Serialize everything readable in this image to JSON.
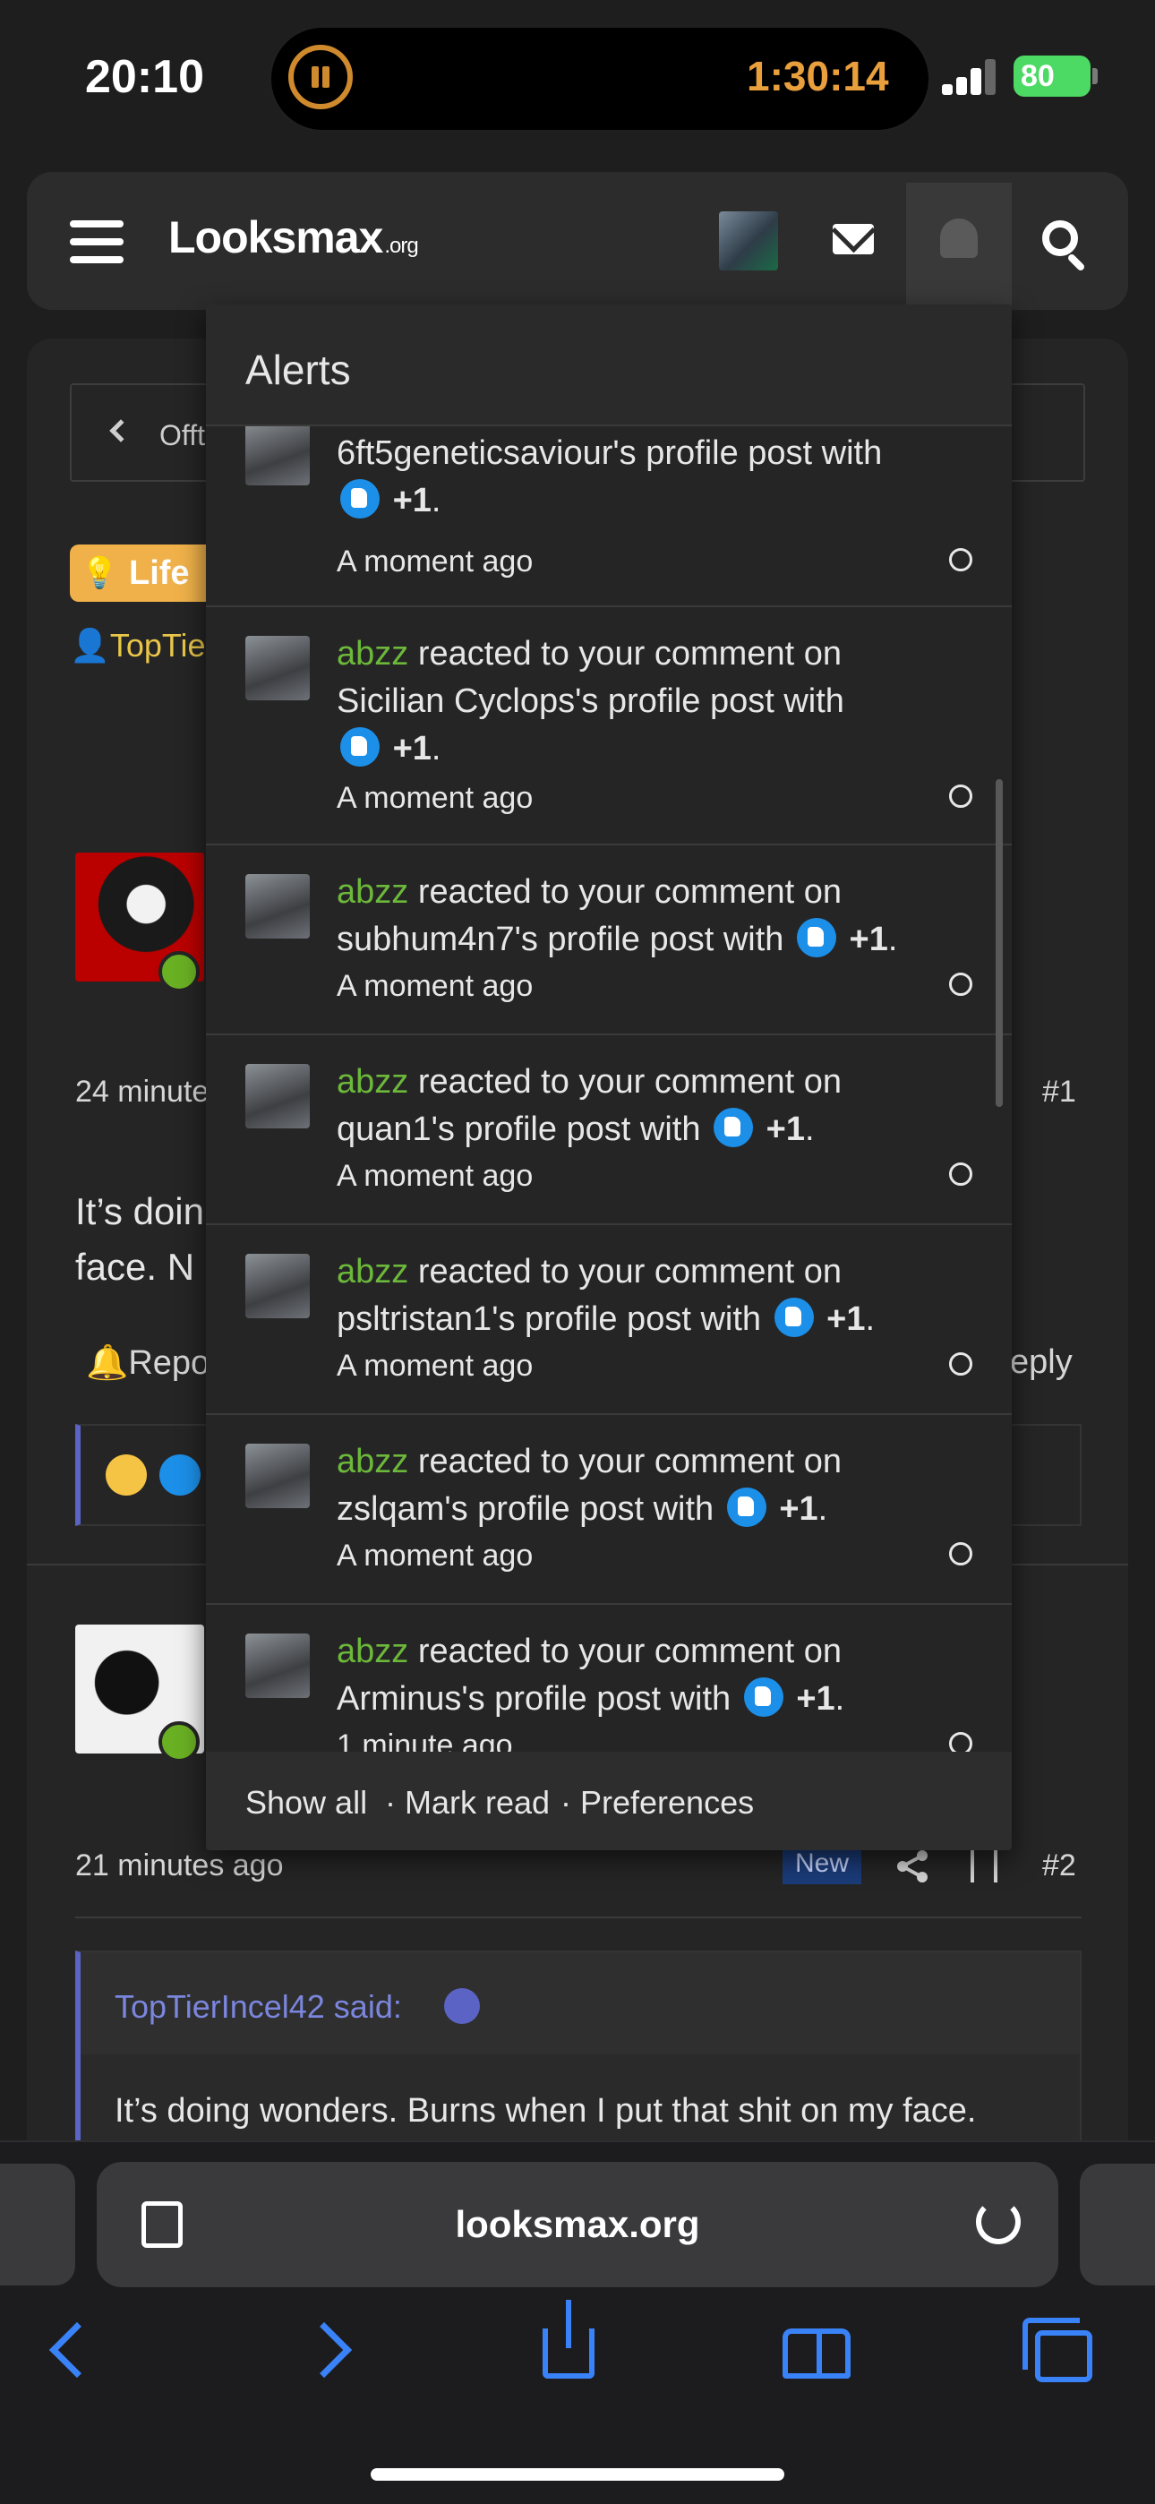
{
  "status_bar": {
    "time": "20:10",
    "timer": "1:30:14",
    "battery": "80"
  },
  "site": {
    "logo": "Looksmax",
    "logo_suffix": ".org"
  },
  "background_page": {
    "breadcrumb": "Offt",
    "label": "Life",
    "author": "TopTie",
    "post1": {
      "time": "24 minute",
      "number": "#1",
      "body": "It’s doin face. N",
      "report": "Repor",
      "reply": "eply"
    },
    "post2": {
      "time": "21 minutes ago",
      "badge": "New",
      "number": "#2"
    },
    "quote": {
      "author": "TopTierIncel42 said:",
      "text": "It’s doing wonders. Burns when I put that shit on my face."
    }
  },
  "alerts": {
    "title": "Alerts",
    "items": [
      {
        "user": "",
        "before": "6ft5geneticsaviour's profile post with",
        "after": "",
        "reaction": "+1",
        "time": "A moment ago"
      },
      {
        "user": "abzz",
        "before": "reacted to your comment on Sicilian Cyclops's profile post with",
        "after": "",
        "reaction": "+1",
        "time": "A moment ago"
      },
      {
        "user": "abzz",
        "before": "reacted to your comment on subhum4n7's profile post with",
        "after": "",
        "reaction": "+1",
        "time": "A moment ago"
      },
      {
        "user": "abzz",
        "before": "reacted to your comment on quan1's profile post with",
        "after": "",
        "reaction": "+1",
        "time": "A moment ago"
      },
      {
        "user": "abzz",
        "before": "reacted to your comment on psltristan1's profile post with",
        "after": "",
        "reaction": "+1",
        "time": "A moment ago"
      },
      {
        "user": "abzz",
        "before": "reacted to your comment on zslqam's profile post with",
        "after": "",
        "reaction": "+1",
        "time": "A moment ago"
      },
      {
        "user": "abzz",
        "before": "reacted to your comment on Arminus's profile post with",
        "after": "",
        "reaction": "+1",
        "time": "1 minute ago"
      }
    ],
    "footer": {
      "show_all": "Show all",
      "mark_read": "Mark read",
      "preferences": "Preferences",
      "sep": "·"
    }
  },
  "browser": {
    "url": "looksmax.org"
  },
  "colors": {
    "username": "#6cb83a",
    "accent": "#3a82f7",
    "quote_author": "#7b86dd",
    "badge": "#f0b14a"
  }
}
